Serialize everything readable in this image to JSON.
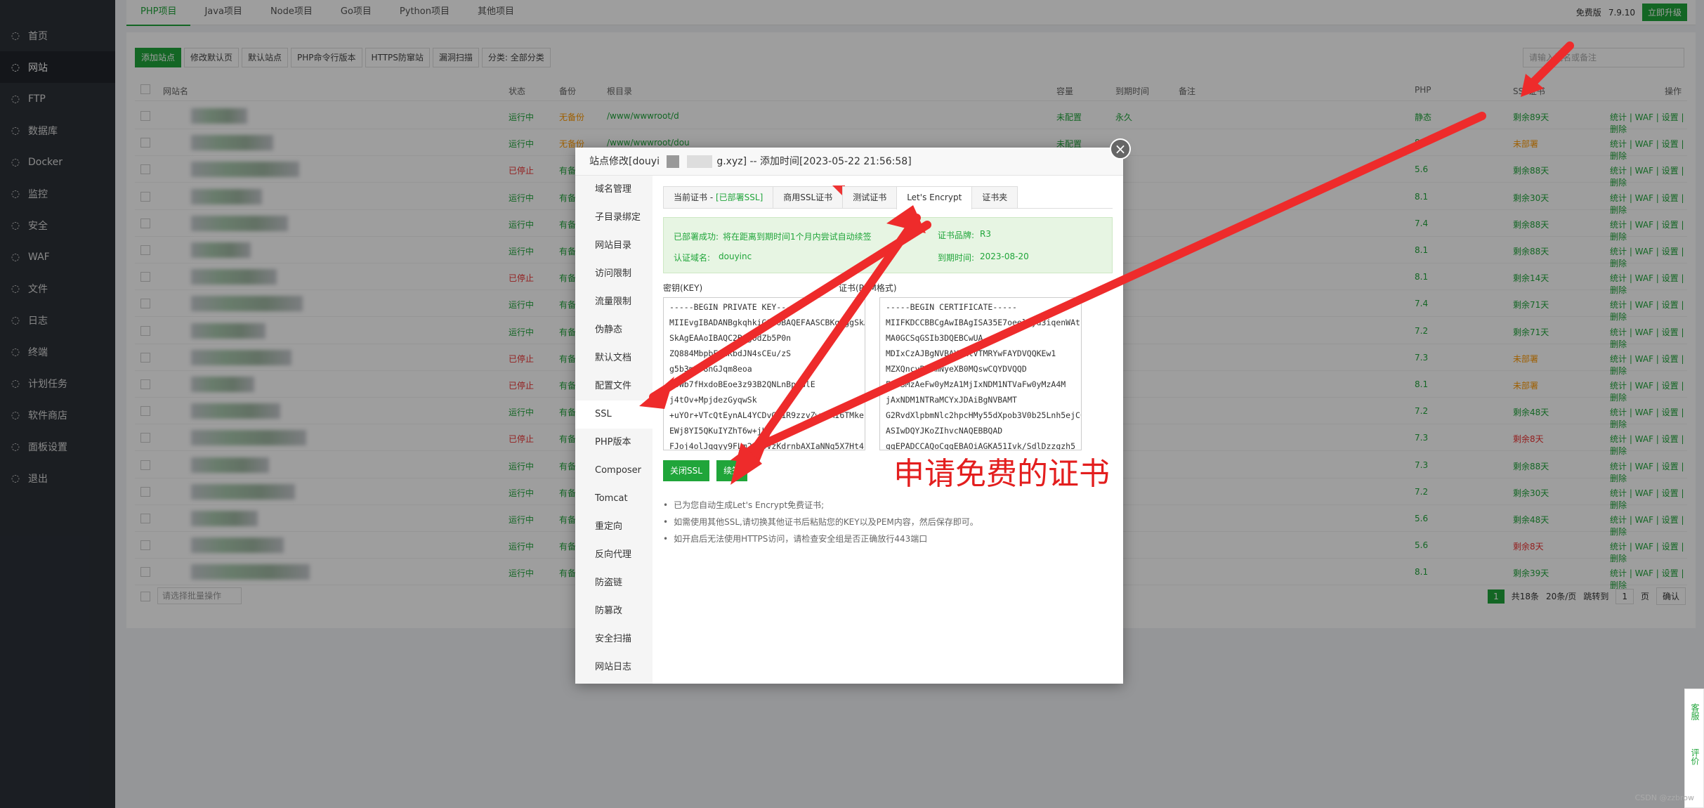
{
  "sidebar": {
    "items": [
      {
        "label": "首页",
        "icon": "home-icon"
      },
      {
        "label": "网站",
        "icon": "globe-icon"
      },
      {
        "label": "FTP",
        "icon": "ftp-icon"
      },
      {
        "label": "数据库",
        "icon": "database-icon"
      },
      {
        "label": "Docker",
        "icon": "docker-icon"
      },
      {
        "label": "监控",
        "icon": "monitor-icon"
      },
      {
        "label": "安全",
        "icon": "shield-icon"
      },
      {
        "label": "WAF",
        "icon": "waf-icon"
      },
      {
        "label": "文件",
        "icon": "folder-icon"
      },
      {
        "label": "日志",
        "icon": "log-icon"
      },
      {
        "label": "终端",
        "icon": "terminal-icon"
      },
      {
        "label": "计划任务",
        "icon": "clock-icon"
      },
      {
        "label": "软件商店",
        "icon": "store-icon"
      },
      {
        "label": "面板设置",
        "icon": "settings-icon"
      },
      {
        "label": "退出",
        "icon": "logout-icon"
      }
    ]
  },
  "topbar": {
    "tabs": [
      "PHP项目",
      "Java项目",
      "Node项目",
      "Go项目",
      "Python项目",
      "其他项目"
    ],
    "edition": "免费版",
    "version": "7.9.10",
    "upgrade": "立即升级"
  },
  "toolbar": {
    "buttons": [
      "添加站点",
      "修改默认页",
      "默认站点",
      "PHP命令行版本",
      "HTTPS防窜站",
      "漏洞扫描",
      "分类: 全部分类"
    ],
    "search_placeholder": "请输入域名或备注"
  },
  "table": {
    "headers": [
      "网站名",
      "状态",
      "备份",
      "根目录",
      "容量",
      "到期时间",
      "备注",
      "PHP",
      "SSL证书",
      "操作"
    ],
    "rows": [
      {
        "status": "运行中",
        "backup": "无备份",
        "root": "/www/wwwroot/d",
        "cap": "未配置",
        "exp": "永久",
        "php": "静态",
        "ssl": "剩余89天"
      },
      {
        "status": "运行中",
        "backup": "无备份",
        "root": "/www/wwwroot/dou",
        "cap": "未配置",
        "exp": "",
        "php": "8.1",
        "ssl": "未部署"
      },
      {
        "status": "已停止",
        "backup": "有备",
        "root": "",
        "cap": "",
        "exp": "",
        "php": "5.6",
        "ssl": "剩余88天"
      },
      {
        "status": "运行中",
        "backup": "有备",
        "root": "",
        "cap": "",
        "exp": "",
        "php": "8.1",
        "ssl": "剩余30天"
      },
      {
        "status": "运行中",
        "backup": "有备",
        "root": "",
        "cap": "",
        "exp": "",
        "php": "7.4",
        "ssl": "剩余88天"
      },
      {
        "status": "运行中",
        "backup": "有备",
        "root": "",
        "cap": "",
        "exp": "",
        "php": "8.1",
        "ssl": "剩余88天"
      },
      {
        "status": "已停止",
        "backup": "有备",
        "root": "",
        "cap": "",
        "exp": "",
        "php": "8.1",
        "ssl": "剩余14天"
      },
      {
        "status": "运行中",
        "backup": "有备",
        "root": "",
        "cap": "",
        "exp": "",
        "php": "7.4",
        "ssl": "剩余71天"
      },
      {
        "status": "运行中",
        "backup": "有备",
        "root": "",
        "cap": "",
        "exp": "",
        "php": "7.2",
        "ssl": "剩余71天"
      },
      {
        "status": "已停止",
        "backup": "有备",
        "root": "",
        "cap": "",
        "exp": "",
        "php": "7.3",
        "ssl": "未部署"
      },
      {
        "status": "已停止",
        "backup": "有备",
        "root": "",
        "cap": "",
        "exp": "",
        "php": "8.1",
        "ssl": "未部署"
      },
      {
        "status": "运行中",
        "backup": "有备",
        "root": "",
        "cap": "",
        "exp": "",
        "php": "7.2",
        "ssl": "剩余48天"
      },
      {
        "status": "已停止",
        "backup": "有备",
        "root": "",
        "cap": "",
        "exp": "",
        "php": "7.3",
        "ssl": "剩余8天"
      },
      {
        "status": "运行中",
        "backup": "有备",
        "root": "",
        "cap": "",
        "exp": "",
        "php": "7.3",
        "ssl": "剩余88天"
      },
      {
        "status": "运行中",
        "backup": "有备",
        "root": "",
        "cap": "",
        "exp": "",
        "php": "7.2",
        "ssl": "剩余30天"
      },
      {
        "status": "运行中",
        "backup": "有备",
        "root": "",
        "cap": "",
        "exp": "",
        "php": "5.6",
        "ssl": "剩余48天"
      },
      {
        "status": "运行中",
        "backup": "有备",
        "root": "",
        "cap": "",
        "exp": "",
        "php": "5.6",
        "ssl": "剩余8天"
      },
      {
        "status": "运行中",
        "backup": "有备",
        "root": "",
        "cap": "",
        "exp": "",
        "php": "8.1",
        "ssl": "剩余39天"
      }
    ],
    "ops": "统计 | WAF | 设置 | 删除",
    "batch_placeholder": "请选择批量操作"
  },
  "pager": {
    "page": "1",
    "total": "共18条",
    "per": "20条/页",
    "jump": "跳转到",
    "jump_val": "1",
    "unit": "页",
    "confirm": "确认"
  },
  "modal": {
    "title": "站点修改[douyi",
    "title_tail": "g.xyz] -- 添加时间[2023-05-22 21:56:58]",
    "side": [
      "域名管理",
      "子目录绑定",
      "网站目录",
      "访问限制",
      "流量限制",
      "伪静态",
      "默认文档",
      "配置文件",
      "SSL",
      "PHP版本",
      "Composer",
      "Tomcat",
      "重定向",
      "反向代理",
      "防盗链",
      "防篡改",
      "安全扫描",
      "网站日志"
    ],
    "tabs": [
      "当前证书 - ",
      "[已部署SSL]",
      "商用SSL证书",
      "测试证书",
      "Let's Encrypt",
      "证书夹"
    ],
    "info_deployed_label": "已部署成功:",
    "info_deployed_text": "将在距离到期时间1个月内尝试自动续签",
    "info_domain_label": "认证域名:",
    "info_domain_val": "douyinc",
    "info_brand_label": "证书品牌:",
    "info_brand_val": "R3",
    "info_expire_label": "到期时间:",
    "info_expire_val": "2023-08-20",
    "key_label": "密钥(KEY)",
    "cert_label": "证书(PEM格式)",
    "key_text": "-----BEGIN PRIVATE KEY-----\nMIIEvgIBADANBgkqhkiG9w0BAQEFAASCBKgwggSkAgEAAoIBAQ\nSkAgEAAoIBAQC2BigOdZb5P0n\nZQ884MbpbFQxKbdJN4sCEu/zS\ng5b3m3f8nGJqm8eoa\nqbWb7fHxdoBEoe3z93B2QNLnBpOGlE\nj4tOv+MpjdezGyqwSk\n+uYOr+VTcQtEynAL4YCDvGN1R9zzvZwqfAI6TMke\nEWj8YI5QKuIYZhT6w+jLK\nFJoj4olJqgyy9FLm2CEoVzKdrnbAXIaNNq5X7Ht4i",
    "cert_text": "-----BEGIN CERTIFICATE-----\nMIIFKDCCBBCgAwIBAgISA35E7oeelDyd3iqenWAt\nMA0GCSqGSIb3DQEBCwUA\nMDIxCzAJBgNVBAYTAlVTMRYwFAYDVQQKEw1\nMZXQncyBFbmNyeXB0MQswCQYDVQQD\nEwJSMzAeFw0yMzA1MjIxNDM1NTVaFw0yMzA4M\njAxNDM1NTRaMCYxJDAiBgNVBAMT\nG2RvdXlpbmNlc2hpcHMy55dXpob3V0b25Lnh5ejCC\nASIwDQYJKoZIhvcNAQEBBQAD\nggEPADCCAQoCggEBAOiAGKA51Ivk/SdlDzzgzh5",
    "btn_close_ssl": "关闭SSL",
    "btn_renew": "续签",
    "tips": [
      "已为您自动生成Let's Encrypt免费证书;",
      "如需使用其他SSL,请切换其他证书后粘贴您的KEY以及PEM内容，然后保存即可。",
      "如开启后无法使用HTTPS访问，请检查安全组是否正确放行443端口"
    ]
  },
  "annotation": "申请免费的证书",
  "watermark": "CSDN @zzbrow",
  "right_tabs": [
    "客服",
    "评价"
  ],
  "colors": {
    "accent": "#20a53a",
    "danger": "#e33333",
    "warn": "#ff9900",
    "arrow": "#ee2b2b"
  }
}
